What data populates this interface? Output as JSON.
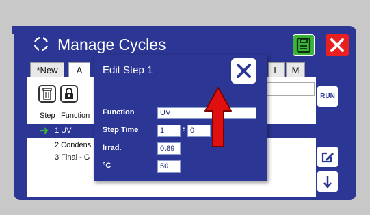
{
  "title": "Manage Cycles",
  "tabs": [
    {
      "label": "*New"
    },
    {
      "label": "A"
    },
    {
      "label": "L"
    },
    {
      "label": "M"
    }
  ],
  "side_buttons": {
    "run_label": "RUN"
  },
  "table": {
    "headers": [
      "Step",
      "Function"
    ],
    "rows": [
      {
        "text": "1 UV",
        "selected": true
      },
      {
        "text": "2 Condens",
        "selected": false
      },
      {
        "text": "3 Final - G",
        "selected": false
      }
    ]
  },
  "dialog": {
    "title": "Edit Step 1",
    "fields": {
      "function": {
        "label": "Function",
        "value": "UV"
      },
      "step_time": {
        "label": "Step Time",
        "hours": "1",
        "separator": ":",
        "minutes": "0"
      },
      "irradiance": {
        "label": "Irrad.",
        "value": "0.89"
      },
      "temperature": {
        "label": "°C",
        "value": "50"
      }
    }
  },
  "icons": [
    "refresh-cycle-icon",
    "save-icon",
    "close-icon",
    "trash-icon",
    "lock-icon",
    "edit-icon",
    "arrow-down-icon",
    "play-icon",
    "up-arrow-overlay"
  ],
  "colors": {
    "primary": "#2c3694",
    "save_green": "#3cb43c",
    "close_red": "#e82020",
    "arrow_red": "#e01010"
  }
}
